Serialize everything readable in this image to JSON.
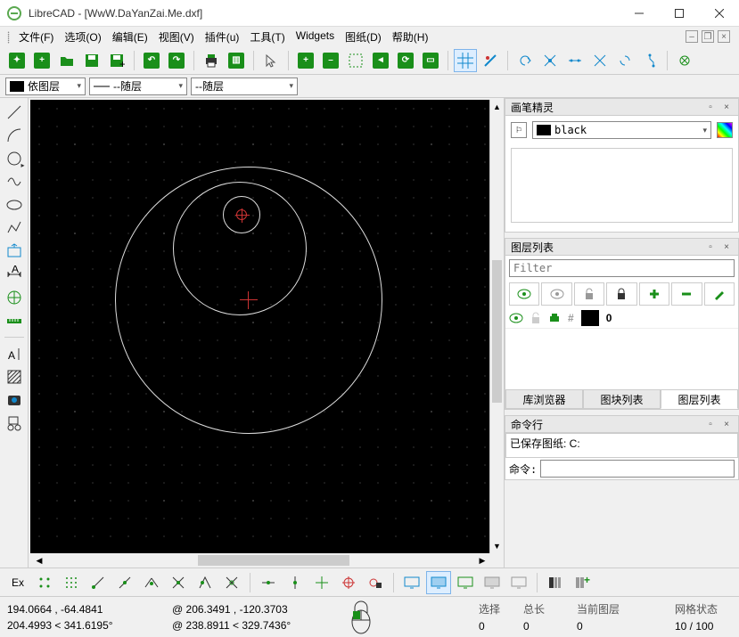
{
  "titlebar": {
    "title": "LibreCAD - [WwW.DaYanZai.Me.dxf]"
  },
  "menu": {
    "file": "文件(F)",
    "options": "选项(O)",
    "edit": "编辑(E)",
    "view": "视图(V)",
    "plugins": "插件(u)",
    "tools": "工具(T)",
    "widgets": "Widgets",
    "drawing": "图纸(D)",
    "help": "帮助(H)"
  },
  "layer_bar": {
    "by_layer": "依图层",
    "by_layer2": "--随层",
    "by_layer3": "--随层"
  },
  "panel": {
    "pen_wizard": "画笔精灵",
    "black": "black",
    "layer_list": "图层列表",
    "filter_ph": "Filter",
    "layer0": "0",
    "tab_lib": "库浏览器",
    "tab_block": "图块列表",
    "tab_layer": "图层列表",
    "cmd_title": "命令行",
    "cmd_out_1": "已保存图纸: C:",
    "cmd_label": "命令:"
  },
  "snap": {
    "ex": "Ex"
  },
  "status": {
    "abs": "194.0664 , -64.4841",
    "polar_abs": "204.4993 < 341.6195°",
    "rel": "@  206.3491 , -120.3703",
    "polar_rel": "@  238.8911 < 329.7436°",
    "sel_lbl": "选择",
    "sel_val": "0",
    "len_lbl": "总长",
    "len_val": "0",
    "cur_layer_lbl": "当前图层",
    "cur_layer_val": "0",
    "grid_lbl": "网格状态",
    "grid_val": "10 / 100"
  }
}
